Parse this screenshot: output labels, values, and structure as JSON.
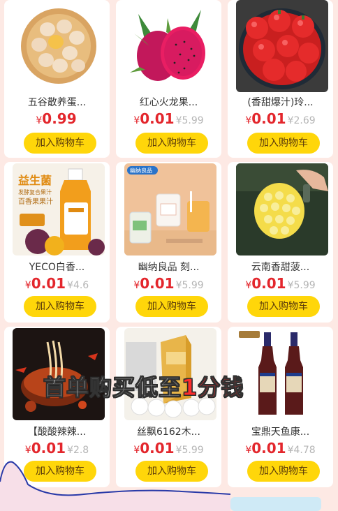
{
  "products": [
    {
      "title": "五谷散养蛋...",
      "currency": "¥",
      "price": "0.99",
      "original": "",
      "button": "加入购物车",
      "image": "eggs-in-basket"
    },
    {
      "title": "红心火龙果...",
      "currency": "¥",
      "price": "0.01",
      "original": "¥5.99",
      "button": "加入购物车",
      "image": "dragon-fruit"
    },
    {
      "title": "(香甜爆汁)玲...",
      "currency": "¥",
      "price": "0.01",
      "original": "¥2.69",
      "button": "加入购物车",
      "image": "cherry-tomatoes"
    },
    {
      "title": "YECO白香...",
      "currency": "¥",
      "price": "0.01",
      "original": "¥4.6",
      "button": "加入购物车",
      "image": "probiotic-juice-bottle"
    },
    {
      "title": "幽纳良品 刻...",
      "currency": "¥",
      "price": "0.01",
      "original": "¥5.99",
      "button": "加入购物车",
      "image": "glass-cups"
    },
    {
      "title": "云南香甜菠...",
      "currency": "¥",
      "price": "0.01",
      "original": "¥5.99",
      "button": "加入购物车",
      "image": "pineapple"
    },
    {
      "title": "【酸酸辣辣...",
      "currency": "¥",
      "price": "0.01",
      "original": "¥2.8",
      "button": "加入购物车",
      "image": "hot-sour-noodles"
    },
    {
      "title": "丝飘6162木...",
      "currency": "¥",
      "price": "0.01",
      "original": "¥5.99",
      "button": "加入购物车",
      "image": "tissue-rolls"
    },
    {
      "title": "宝鼎天鱼康...",
      "currency": "¥",
      "price": "0.01",
      "original": "¥4.78",
      "button": "加入购物车",
      "image": "vinegar-bottles"
    }
  ],
  "juice_label": {
    "title": "益生菌",
    "sub1": "发酵复合果汁",
    "sub2": "百香果果汁"
  },
  "cups_brand": "幽纳良品",
  "overlay": {
    "prefix": "首单购买低至",
    "highlight": "1分钱"
  },
  "colors": {
    "price": "#e3262c",
    "button": "#ffd60a",
    "background": "#fde9e4"
  }
}
